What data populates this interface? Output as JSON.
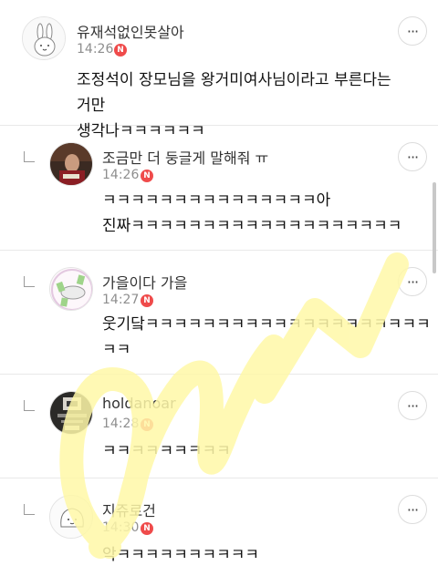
{
  "comments": [
    {
      "author": "유재석없인못살아",
      "time": "14:26",
      "badge": "N",
      "text": "조정석이 장모님을 왕거미여사님이라고 부른다는 거만\n생각나ㅋㅋㅋㅋㅋㅋ",
      "avatar_icon": "bunny-avatar-icon",
      "is_reply": false
    },
    {
      "author": "조금만 더 둥글게 말해줘 ㅠ",
      "time": "14:26",
      "badge": "N",
      "text": "ㅋㅋㅋㅋㅋㅋㅋㅋㅋㅋㅋㅋㅋㅋㅋ아\n진짜ㅋㅋㅋㅋㅋㅋㅋㅋㅋㅋㅋㅋㅋㅋㅋㅋㅋㅋㅋ",
      "avatar_icon": "photo-avatar-icon",
      "is_reply": true
    },
    {
      "author": "가을이다 가을",
      "time": "14:27",
      "badge": "N",
      "text": "웃기닼ㅋㅋㅋㅋㅋㅋㅋㅋㅋㅋㅋㅋㅋㅋㅋㅋㅋㅋㅋㅋ\nㅋㅋ",
      "avatar_icon": "money-cloud-avatar-icon",
      "is_reply": true
    },
    {
      "author": "holdanoar",
      "time": "14:28",
      "badge": "N",
      "text": "ㅋㅋㅋㅋㅋㅋㅋㅋㅋ",
      "avatar_icon": "dark-photo-avatar-icon",
      "is_reply": true
    },
    {
      "author": "지쥬로건",
      "time": "14:30",
      "badge": "N",
      "text": "악ㅋㅋㅋㅋㅋㅋㅋㅋㅋㅋ",
      "avatar_icon": "doodle-avatar-icon",
      "is_reply": true
    }
  ],
  "more_icon": "more-options-icon",
  "more_label": "···",
  "reply_icon": "reply-arrow-icon",
  "colors": {
    "badge": "#ef4b4b",
    "watermark": "#fff8a8",
    "divider": "#e9e9e9",
    "time": "#8e8e8e"
  }
}
